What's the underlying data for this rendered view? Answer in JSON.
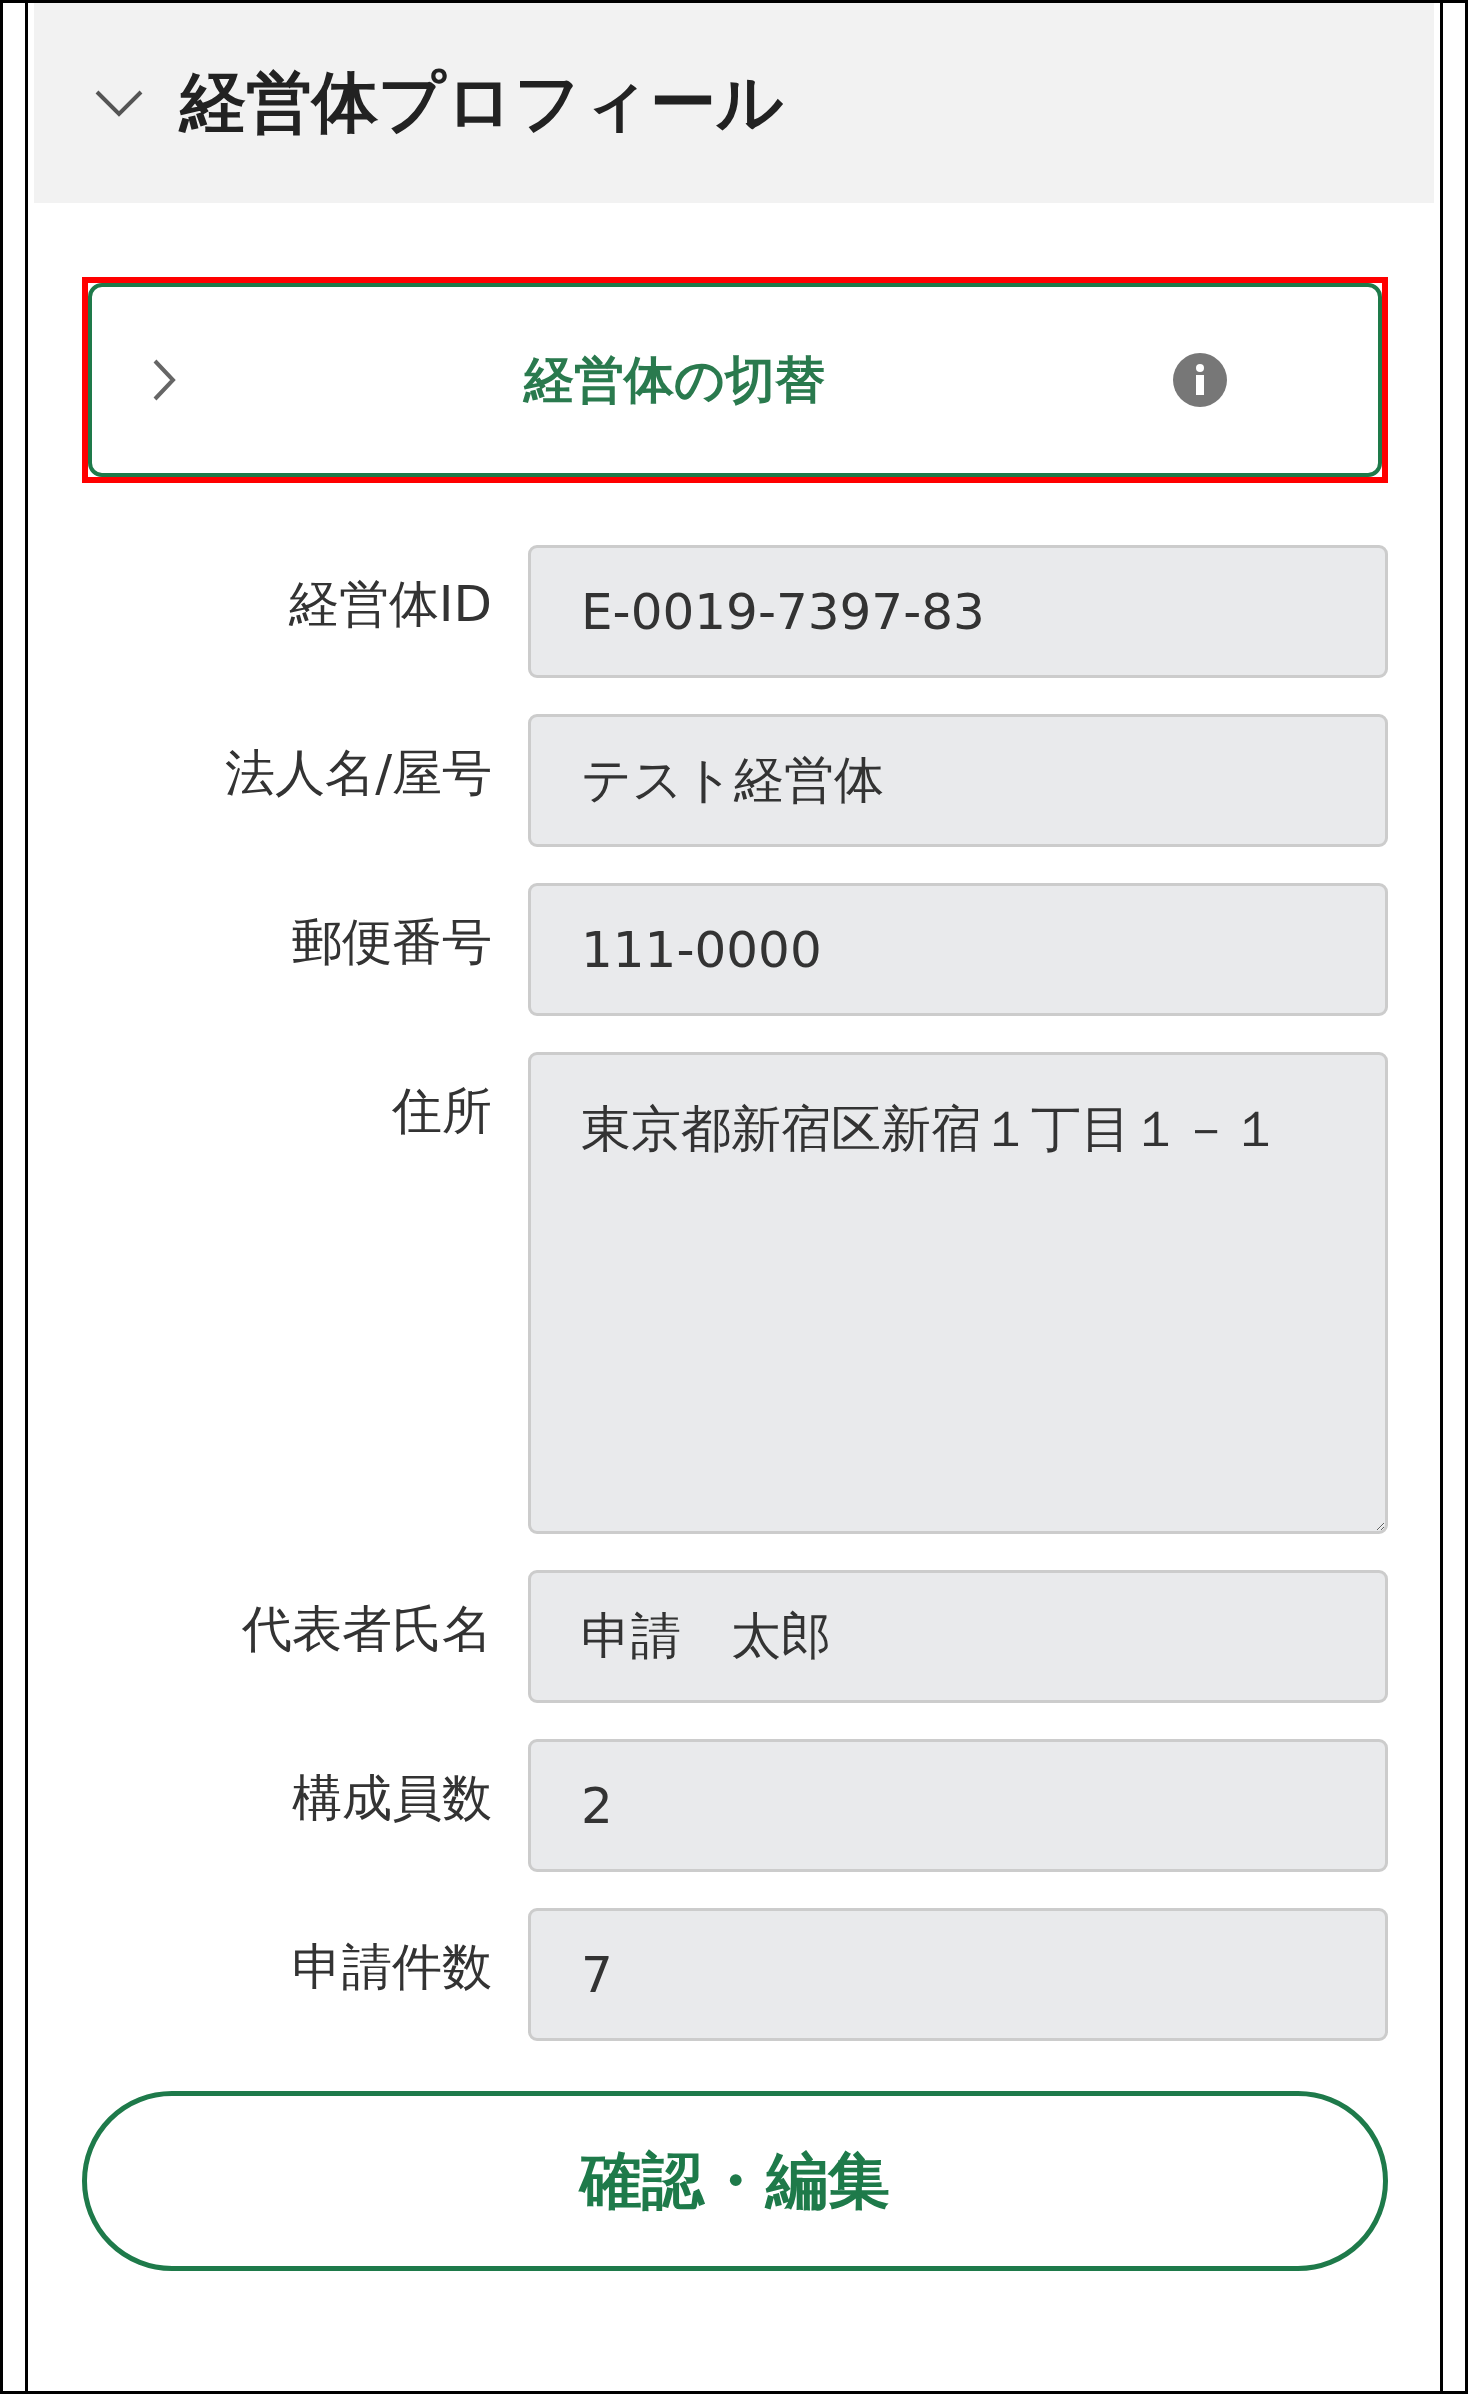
{
  "panel": {
    "title": "経営体プロフィール",
    "expanded": true
  },
  "switcher": {
    "label": "経営体の切替",
    "expanded": false,
    "highlighted": true
  },
  "fields": [
    {
      "kind": "input",
      "label": "経営体ID",
      "value": "E-0019-7397-83"
    },
    {
      "kind": "input",
      "label": "法人名/屋号",
      "value": "テスト経営体"
    },
    {
      "kind": "input",
      "label": "郵便番号",
      "value": "111-0000"
    },
    {
      "kind": "textarea",
      "label": "住所",
      "value": "東京都新宿区新宿１丁目１－１"
    },
    {
      "kind": "input",
      "label": "代表者氏名",
      "value": "申請　太郎"
    },
    {
      "kind": "input",
      "label": "構成員数",
      "value": "2"
    },
    {
      "kind": "input",
      "label": "申請件数",
      "value": "7"
    }
  ],
  "buttons": [
    "確認・編集"
  ]
}
